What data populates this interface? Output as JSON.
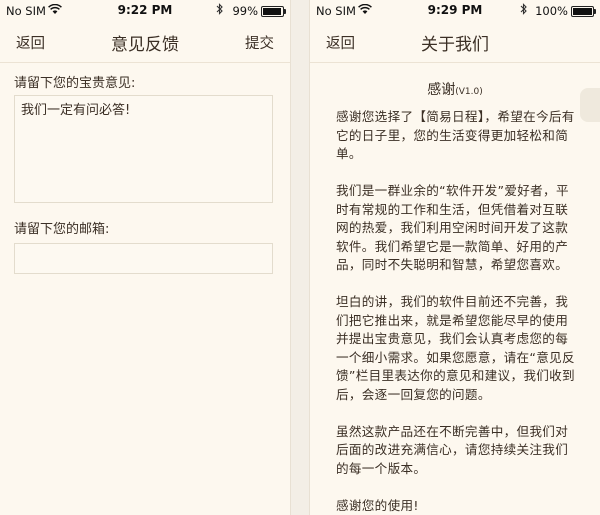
{
  "left": {
    "status": {
      "carrier": "No SIM",
      "time": "9:22 PM",
      "battery_pct": "99%",
      "battery_level": 0.99
    },
    "nav": {
      "back": "返回",
      "title": "意见反馈",
      "submit": "提交"
    },
    "feedback_label": "请留下您的宝贵意见:",
    "feedback_text": "我们一定有问必答!",
    "email_label": "请留下您的邮箱:",
    "email_value": ""
  },
  "right": {
    "status": {
      "carrier": "No SIM",
      "time": "9:29 PM",
      "battery_pct": "100%",
      "battery_level": 1.0
    },
    "nav": {
      "back": "返回",
      "title": "关于我们"
    },
    "heading": "感谢",
    "version": "(V1.0)",
    "paragraphs": [
      "感谢您选择了【简易日程】，希望在今后有它的日子里，您的生活变得更加轻松和简单。",
      "我们是一群业余的“软件开发”爱好者，平时有常规的工作和生活，但凭借着对互联网的热爱，我们利用空闲时间开发了这款软件。我们希望它是一款简单、好用的产品，同时不失聪明和智慧，希望您喜欢。",
      "坦白的讲，我们的软件目前还不完善，我们把它推出来，就是希望您能尽早的使用并提出宝贵意见，我们会认真考虑您的每一个细小需求。如果您愿意，请在“意见反馈”栏目里表达你的意见和建议，我们收到后，会逐一回复您的问题。",
      "虽然这款产品还在不断完善中，但我们对后面的改进充满信心，请您持续关注我们的每一个版本。",
      "感谢您的使用!"
    ]
  },
  "icons": {
    "wifi": "wifi-icon",
    "bluetooth": "bluetooth-icon",
    "battery": "battery-icon"
  }
}
